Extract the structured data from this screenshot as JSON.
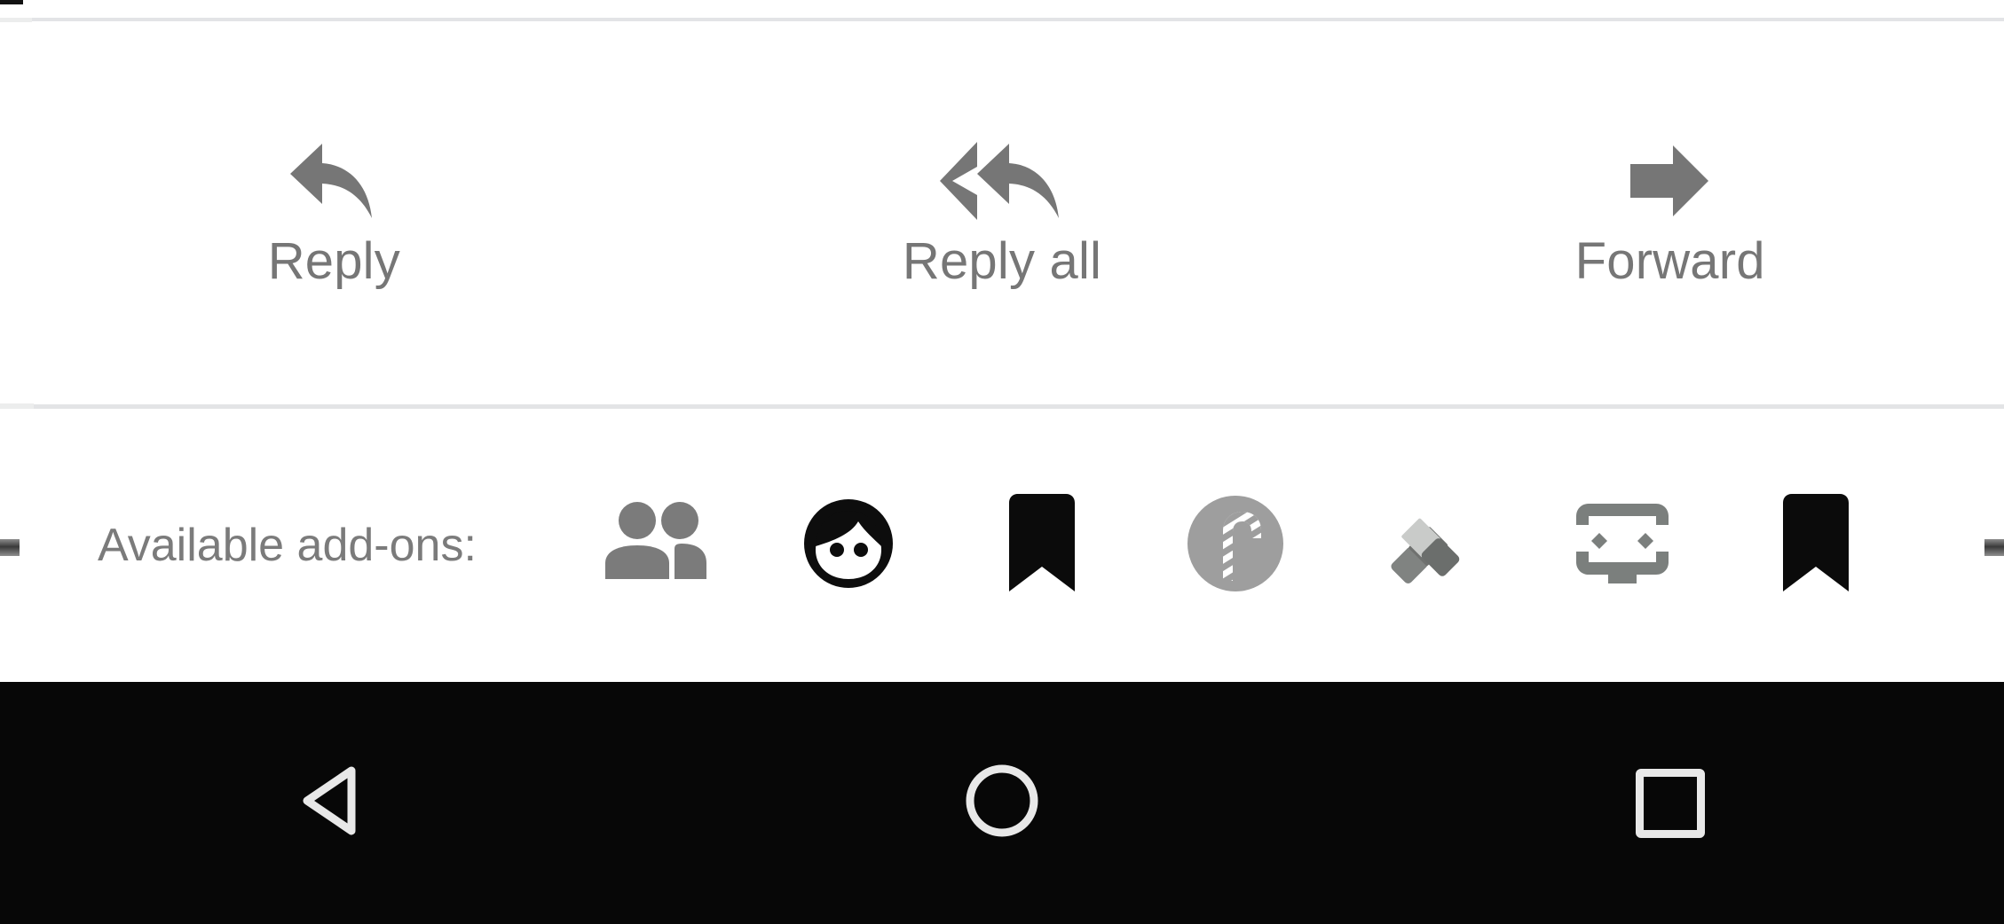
{
  "screen": {
    "background": "#ffffff",
    "divider_color": "#e3e4e6",
    "label_color": "#767676"
  },
  "action_bar": {
    "items": [
      {
        "label": "Reply",
        "icon": "reply-arrow-icon"
      },
      {
        "label": "Reply all",
        "icon": "reply-all-arrow-icon"
      },
      {
        "label": "Forward",
        "icon": "forward-arrow-icon"
      }
    ]
  },
  "addons": {
    "label": "Available add-ons:",
    "items": [
      {
        "icon": "people-contacts-icon",
        "color": "#7b7b7b"
      },
      {
        "icon": "face-avatar-icon",
        "color": "#0d0d0d"
      },
      {
        "icon": "bookmark-icon",
        "color": "#0b0b0b"
      },
      {
        "icon": "candy-cane-circle-icon",
        "color": "#9e9e9e"
      },
      {
        "icon": "tasks-check-icon",
        "color": "#7a7d7b"
      },
      {
        "icon": "code-screen-icon",
        "color": "#7b7f7d"
      },
      {
        "icon": "bookmark-icon",
        "color": "#0b0b0b"
      }
    ]
  },
  "nav_bar": {
    "background": "#070707",
    "icon_color": "#e8e8e8",
    "buttons": [
      {
        "name": "back",
        "icon": "back-triangle-icon"
      },
      {
        "name": "home",
        "icon": "home-circle-icon"
      },
      {
        "name": "recents",
        "icon": "recents-square-icon"
      }
    ]
  }
}
